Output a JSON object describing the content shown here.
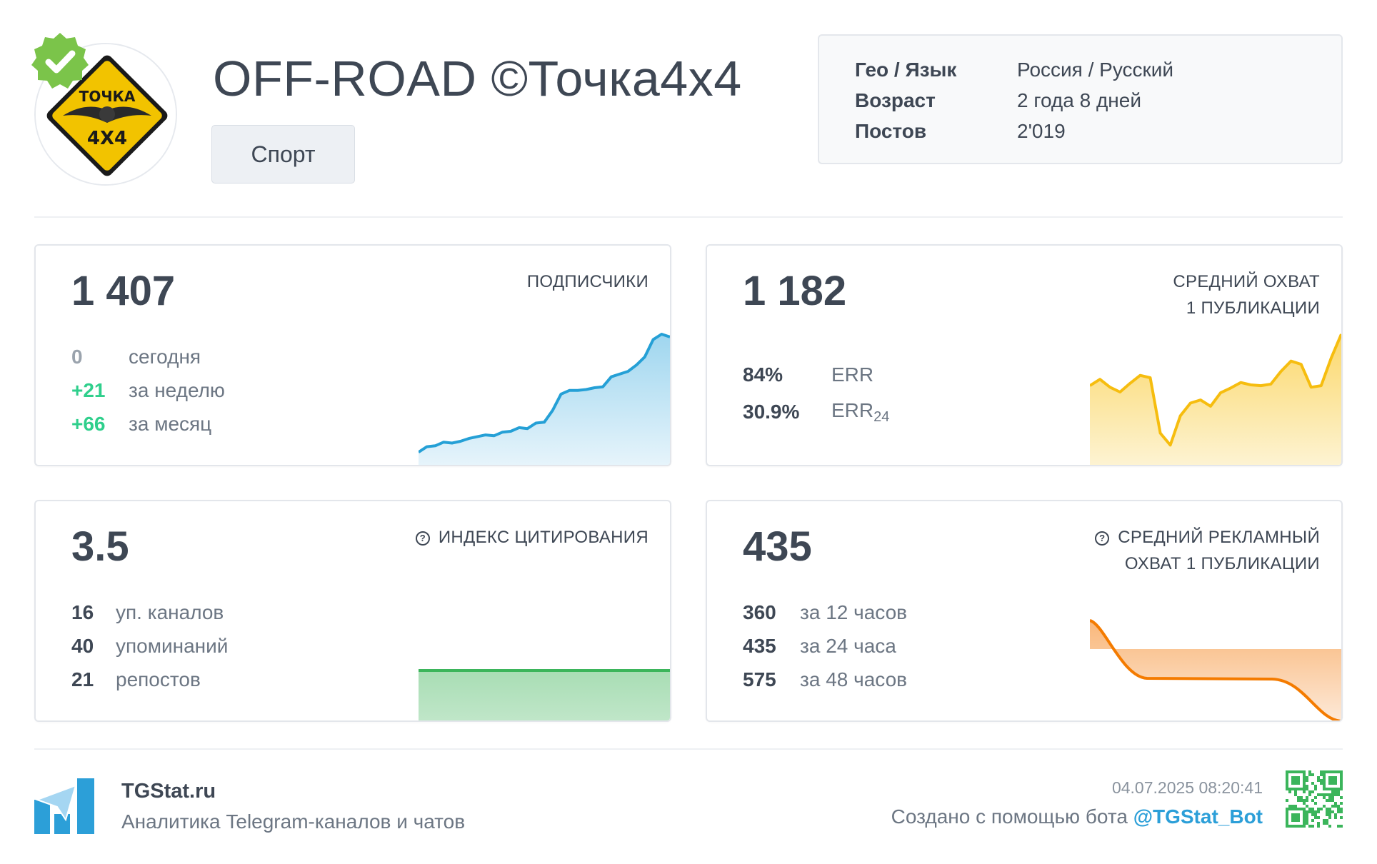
{
  "header": {
    "title": "OFF-ROAD ©Точка4х4",
    "category": "Спорт",
    "logo_text_top": "ТОЧКА",
    "logo_text_bottom": "4X4"
  },
  "info": [
    {
      "key": "Гео / Язык",
      "value": "Россия / Русский"
    },
    {
      "key": "Возраст",
      "value": "2 года 8 дней"
    },
    {
      "key": "Постов",
      "value": "2'019"
    }
  ],
  "subscribers": {
    "value": "1 407",
    "label": "ПОДПИСЧИКИ",
    "rows": [
      {
        "num": "0",
        "text": "сегодня",
        "color": "#9aa3ad"
      },
      {
        "num": "+21",
        "text": "за неделю",
        "color": "#2fcf8c"
      },
      {
        "num": "+66",
        "text": "за месяц",
        "color": "#2fcf8c"
      }
    ],
    "trend": [
      14,
      20,
      21,
      25,
      24,
      26,
      29,
      31,
      33,
      32,
      36,
      37,
      41,
      40,
      46,
      47,
      60,
      78,
      82,
      82,
      83,
      85,
      86,
      97,
      100,
      103,
      110,
      119,
      138,
      144,
      141
    ]
  },
  "avg_reach": {
    "value": "1 182",
    "label_line1": "СРЕДНИЙ ОХВАТ",
    "label_line2": "1 ПУБЛИКАЦИИ",
    "err_value": "84%",
    "err_label": "ERR",
    "err24_value": "30.9%",
    "err24_label": "ERR",
    "err24_sub": "24",
    "trend": [
      100,
      108,
      98,
      92,
      103,
      113,
      110,
      40,
      25,
      62,
      78,
      82,
      74,
      91,
      97,
      104,
      101,
      100,
      102,
      118,
      131,
      127,
      98,
      100,
      135,
      165
    ]
  },
  "citation": {
    "value": "3.5",
    "label": "ИНДЕКС ЦИТИРОВАНИЯ",
    "help_icon": "?",
    "rows": [
      {
        "num": "16",
        "text": "уп. каналов"
      },
      {
        "num": "40",
        "text": "упоминаний"
      },
      {
        "num": "21",
        "text": "репостов"
      }
    ]
  },
  "ad_reach": {
    "value": "435",
    "label_line1": "СРЕДНИЙ РЕКЛАМНЫЙ",
    "label_line2": "ОХВАТ 1 ПУБЛИКАЦИИ",
    "help_icon": "?",
    "rows": [
      {
        "num": "360",
        "text": "за 12 часов"
      },
      {
        "num": "435",
        "text": "за 24 часа"
      },
      {
        "num": "575",
        "text": "за 48 часов"
      }
    ]
  },
  "footer": {
    "brand_name": "TGStat.ru",
    "brand_sub": "Аналитика Telegram-каналов и чатов",
    "timestamp": "04.07.2025 08:20:41",
    "created_prefix": "Создано с помощью бота ",
    "bot_handle": "@TGStat_Bot"
  },
  "colors": {
    "subscribers_line": "#25a0d6",
    "reach_line": "#f6bd0f",
    "citation_line": "#3bb55b",
    "ad_line": "#f47b00",
    "positive": "#2fcf8c",
    "link": "#2c9fd8"
  }
}
